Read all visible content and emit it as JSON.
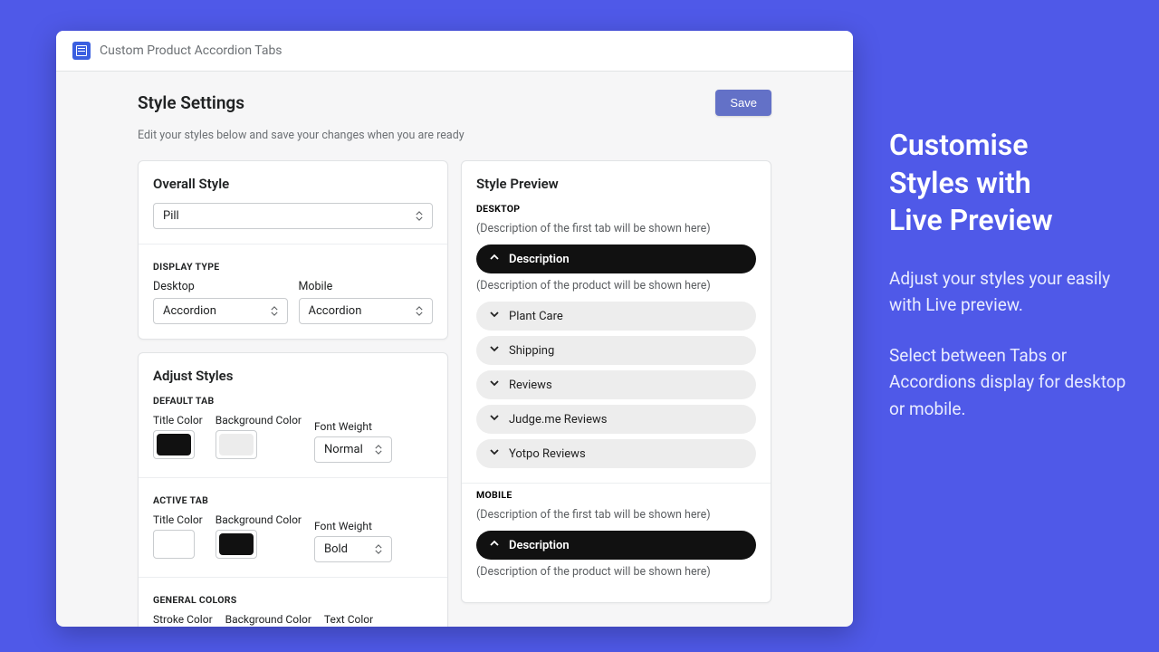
{
  "app": {
    "title": "Custom Product Accordion Tabs"
  },
  "page": {
    "title": "Style Settings",
    "subtitle": "Edit your styles below and save your changes when you are ready",
    "save_label": "Save"
  },
  "overall": {
    "heading": "Overall Style",
    "style_value": "Pill",
    "display_type_label": "DISPLAY TYPE",
    "desktop_label": "Desktop",
    "mobile_label": "Mobile",
    "desktop_value": "Accordion",
    "mobile_value": "Accordion"
  },
  "adjust": {
    "heading": "Adjust Styles",
    "default_tab_label": "DEFAULT TAB",
    "active_tab_label": "ACTIVE TAB",
    "general_label": "GENERAL COLORS",
    "title_color_label": "Title Color",
    "bg_color_label": "Background Color",
    "font_weight_label": "Font Weight",
    "default_title_color": "#111111",
    "default_bg_color": "#ececec",
    "default_fw": "Normal",
    "active_title_color": "#ffffff",
    "active_bg_color": "#111111",
    "active_fw": "Bold",
    "stroke_label": "Stroke Color",
    "gbg_label": "Background Color",
    "text_label": "Text Color"
  },
  "preview": {
    "heading": "Style Preview",
    "desktop_label": "DESKTOP",
    "mobile_label": "MOBILE",
    "first_tab_note": "(Description of the first tab will be shown here)",
    "product_note": "(Description of the product will be shown here)",
    "active_item": "Description",
    "items": [
      "Plant Care",
      "Shipping",
      "Reviews",
      "Judge.me Reviews",
      "Yotpo Reviews"
    ]
  },
  "promo": {
    "headline_1": "Customise",
    "headline_2": "Styles with",
    "headline_3": "Live Preview",
    "para_1": "Adjust your styles your easily with Live preview.",
    "para_2": "Select between Tabs or Accordions display for desktop or mobile."
  }
}
